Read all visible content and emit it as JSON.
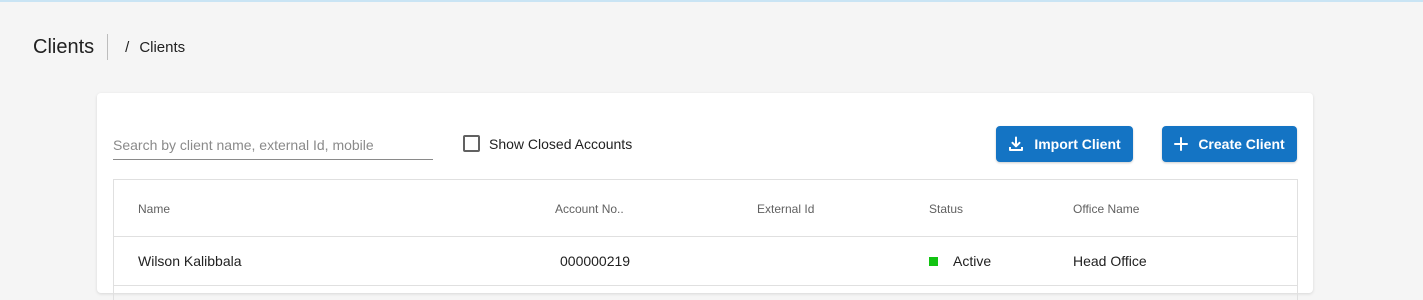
{
  "page": {
    "title": "Clients",
    "breadcrumb": {
      "separator": "/",
      "current": "Clients"
    }
  },
  "toolbar": {
    "search_placeholder": "Search by client name, external Id, mobile",
    "search_value": "",
    "show_closed_label": "Show Closed Accounts",
    "show_closed_checked": false,
    "import_label": "Import Client",
    "create_label": "Create Client"
  },
  "table": {
    "headers": {
      "name": "Name",
      "account_no": "Account No..",
      "external_id": "External Id",
      "status": "Status",
      "office_name": "Office Name"
    },
    "rows": [
      {
        "name": "Wilson Kalibbala",
        "account_no": "000000219",
        "external_id": "",
        "status": "Active",
        "office_name": "Head Office"
      }
    ]
  },
  "colors": {
    "primary": "#1474c4",
    "status_active": "#12c312"
  }
}
